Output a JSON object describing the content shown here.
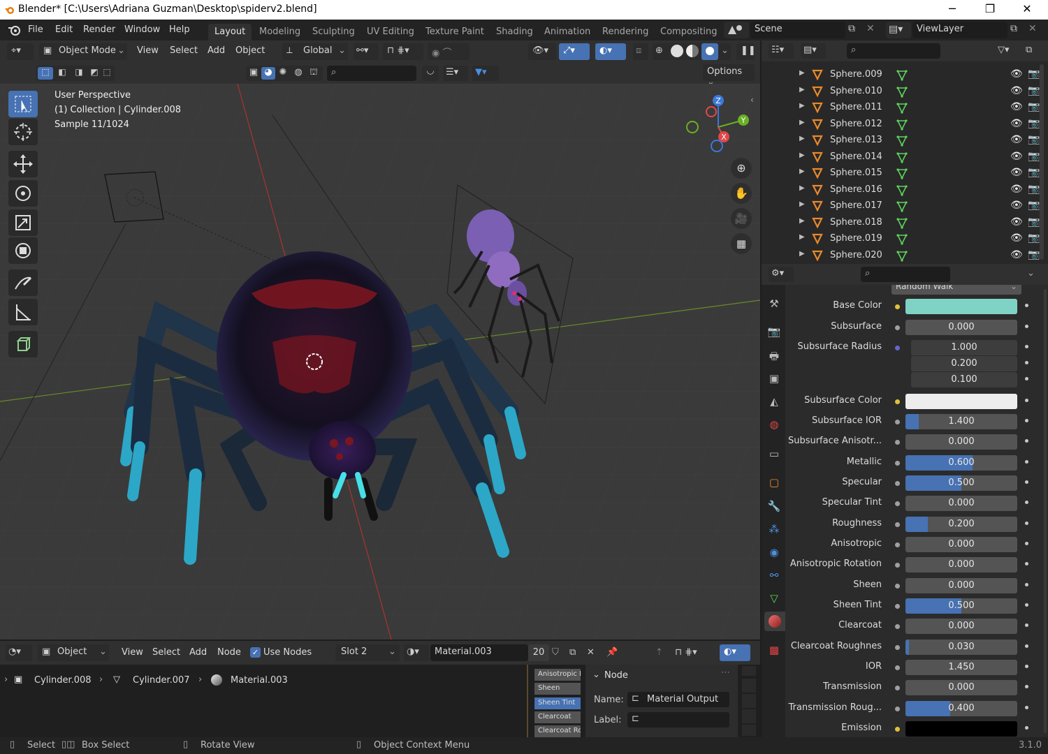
{
  "window": {
    "title": "Blender* [C:\\Users\\Adriana Guzman\\Desktop\\spiderv2.blend]",
    "minimize": "─",
    "restore": "❐",
    "close": "✕"
  },
  "menus": [
    "File",
    "Edit",
    "Render",
    "Window",
    "Help"
  ],
  "workspaces": [
    "Layout",
    "Modeling",
    "Sculpting",
    "UV Editing",
    "Texture Paint",
    "Shading",
    "Animation",
    "Rendering",
    "Compositing"
  ],
  "scene": {
    "label": "Scene",
    "view_layer": "ViewLayer"
  },
  "viewport_header": {
    "mode": "Object Mode",
    "menus": [
      "View",
      "Select",
      "Add",
      "Object"
    ],
    "orientation": "Global",
    "options": "Options"
  },
  "viewport": {
    "perspective": "User Perspective",
    "collection": "(1) Collection | Cylinder.008",
    "sample": "Sample 11/1024",
    "gizmo": {
      "x": "X",
      "y": "Y",
      "z": "Z"
    }
  },
  "outliner": {
    "items": [
      "Sphere.009",
      "Sphere.010",
      "Sphere.011",
      "Sphere.012",
      "Sphere.013",
      "Sphere.014",
      "Sphere.015",
      "Sphere.016",
      "Sphere.017",
      "Sphere.018",
      "Sphere.019",
      "Sphere.020"
    ]
  },
  "properties": {
    "subsurface_method": "Random Walk",
    "rows": [
      {
        "label": "Base Color",
        "type": "color",
        "color": "#7fd3c4",
        "dot": "#e0c23a"
      },
      {
        "label": "Subsurface",
        "type": "num",
        "value": "0.000",
        "fill": 0
      },
      {
        "label": "Subsurface Radius",
        "type": "num",
        "value": "1.000",
        "fill": 0,
        "dot": "#6565cf"
      },
      {
        "label": "",
        "type": "num",
        "value": "0.200",
        "fill": 0,
        "nodot": true
      },
      {
        "label": "",
        "type": "num",
        "value": "0.100",
        "fill": 0,
        "nodot": true
      },
      {
        "label": "Subsurface Color",
        "type": "color",
        "color": "#ededed",
        "dot": "#e0c23a"
      },
      {
        "label": "Subsurface IOR",
        "type": "num",
        "value": "1.400",
        "fill": 0.12
      },
      {
        "label": "Subsurface Anisotr...",
        "type": "num",
        "value": "0.000",
        "fill": 0
      },
      {
        "label": "Metallic",
        "type": "num",
        "value": "0.600",
        "fill": 0.6
      },
      {
        "label": "Specular",
        "type": "num",
        "value": "0.500",
        "fill": 0.5
      },
      {
        "label": "Specular Tint",
        "type": "num",
        "value": "0.000",
        "fill": 0
      },
      {
        "label": "Roughness",
        "type": "num",
        "value": "0.200",
        "fill": 0.2
      },
      {
        "label": "Anisotropic",
        "type": "num",
        "value": "0.000",
        "fill": 0
      },
      {
        "label": "Anisotropic Rotation",
        "type": "num",
        "value": "0.000",
        "fill": 0
      },
      {
        "label": "Sheen",
        "type": "num",
        "value": "0.000",
        "fill": 0
      },
      {
        "label": "Sheen Tint",
        "type": "num",
        "value": "0.500",
        "fill": 0.5
      },
      {
        "label": "Clearcoat",
        "type": "num",
        "value": "0.000",
        "fill": 0
      },
      {
        "label": "Clearcoat Roughnes",
        "type": "num",
        "value": "0.030",
        "fill": 0.03
      },
      {
        "label": "IOR",
        "type": "num",
        "value": "1.450",
        "fill": 0
      },
      {
        "label": "Transmission",
        "type": "num",
        "value": "0.000",
        "fill": 0
      },
      {
        "label": "Transmission Roug...",
        "type": "num",
        "value": "0.400",
        "fill": 0.4
      },
      {
        "label": "Emission",
        "type": "color",
        "color": "#000000",
        "dot": "#e0c23a"
      }
    ]
  },
  "node_editor": {
    "type": "Object",
    "menus": [
      "View",
      "Select",
      "Add",
      "Node"
    ],
    "use_nodes": "Use Nodes",
    "slot": "Slot 2",
    "material": "Material.003",
    "users": "20",
    "breadcrumb": [
      "Cylinder.008",
      "Cylinder.007",
      "Material.003"
    ],
    "sockets": [
      "Anisotropic R",
      "Sheen",
      "Sheen Tint",
      "Clearcoat",
      "Clearcoat Ro"
    ],
    "node_panel": {
      "title": "Node",
      "name_label": "Name:",
      "name_value": "Material Output",
      "label_label": "Label:"
    }
  },
  "statusbar": {
    "select": "Select",
    "box_select": "Box Select",
    "rotate": "Rotate View",
    "context": "Object Context Menu",
    "version": "3.1.0"
  }
}
